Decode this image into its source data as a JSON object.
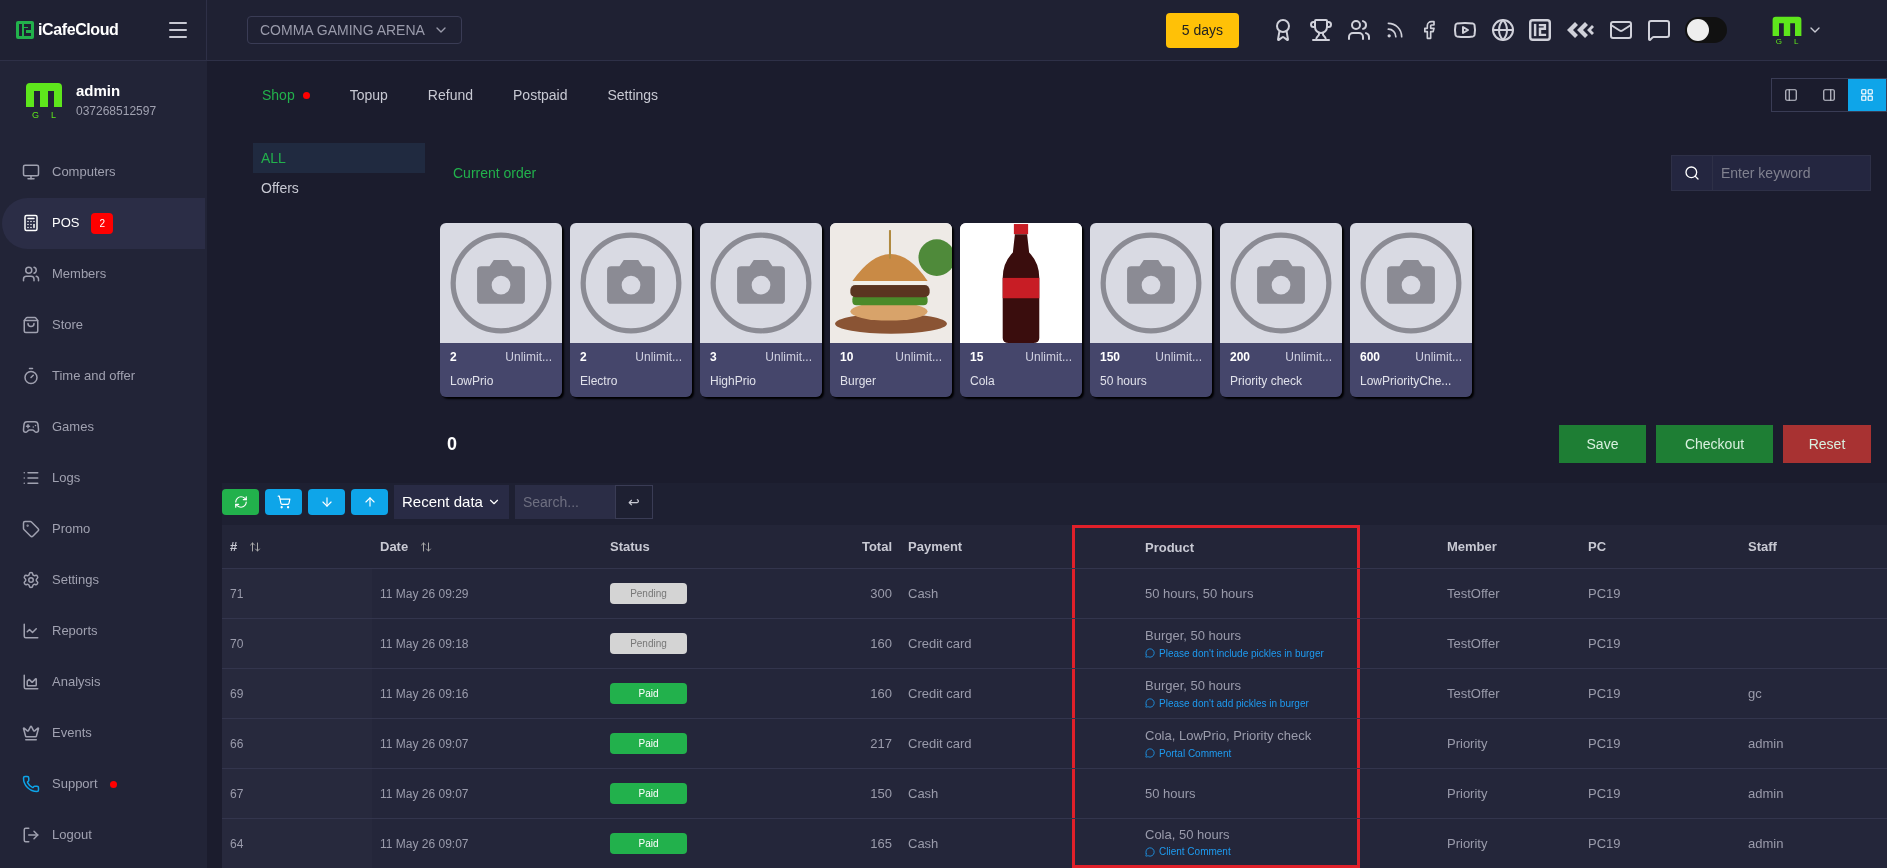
{
  "brand": "iCafeCloud",
  "venue": "COMMA GAMING ARENA",
  "days_badge": "5 days",
  "account_logo_letters": [
    "G",
    "L"
  ],
  "theme_toggle": {
    "on": false
  },
  "user": {
    "name": "admin",
    "phone": "037268512597",
    "logo_letters": [
      "G",
      "L"
    ]
  },
  "sidebar": {
    "items": [
      {
        "label": "Computers",
        "selected": false
      },
      {
        "label": "POS",
        "selected": true,
        "badge": "2"
      },
      {
        "label": "Members",
        "selected": false
      },
      {
        "label": "Store",
        "selected": false
      },
      {
        "label": "Time and offer",
        "selected": false
      },
      {
        "label": "Games",
        "selected": false
      },
      {
        "label": "Logs",
        "selected": false
      },
      {
        "label": "Promo",
        "selected": false
      },
      {
        "label": "Settings",
        "selected": false
      },
      {
        "label": "Reports",
        "selected": false
      },
      {
        "label": "Analysis",
        "selected": false
      },
      {
        "label": "Events",
        "selected": false
      },
      {
        "label": "Support",
        "selected": false,
        "dot": true
      },
      {
        "label": "Logout",
        "selected": false
      }
    ]
  },
  "tabs": [
    {
      "label": "Shop",
      "selected": true,
      "dot": true
    },
    {
      "label": "Topup",
      "selected": false
    },
    {
      "label": "Refund",
      "selected": false
    },
    {
      "label": "Postpaid",
      "selected": false
    },
    {
      "label": "Settings",
      "selected": false
    }
  ],
  "view_toggles": [
    {
      "selected": false
    },
    {
      "selected": false
    },
    {
      "selected": true
    }
  ],
  "categories": [
    {
      "label": "ALL",
      "selected": true
    },
    {
      "label": "Offers",
      "selected": false
    }
  ],
  "current_order": "Current order",
  "search": {
    "placeholder": "Enter keyword"
  },
  "products": [
    {
      "price": "2",
      "stock": "Unlimit...",
      "name": "LowPrio",
      "kind": "placeholder"
    },
    {
      "price": "2",
      "stock": "Unlimit...",
      "name": "Electro",
      "kind": "placeholder"
    },
    {
      "price": "3",
      "stock": "Unlimit...",
      "name": "HighPrio",
      "kind": "placeholder"
    },
    {
      "price": "10",
      "stock": "Unlimit...",
      "name": "Burger",
      "kind": "burger"
    },
    {
      "price": "15",
      "stock": "Unlimit...",
      "name": "Cola",
      "kind": "bottle"
    },
    {
      "price": "150",
      "stock": "Unlimit...",
      "name": "50 hours",
      "kind": "placeholder"
    },
    {
      "price": "200",
      "stock": "Unlimit...",
      "name": "Priority check",
      "kind": "placeholder"
    },
    {
      "price": "600",
      "stock": "Unlimit...",
      "name": "LowPriorityChe...",
      "kind": "placeholder"
    }
  ],
  "order_total": "0",
  "actions": [
    "Save",
    "Checkout",
    "Reset"
  ],
  "filter": {
    "range": "Recent data",
    "placeholder": "Search...",
    "enter": "↩"
  },
  "table": {
    "columns": [
      {
        "label": "#",
        "sortable": true
      },
      {
        "label": "Date",
        "sortable": true
      },
      {
        "label": "Status",
        "sortable": false
      },
      {
        "label": "Total",
        "sortable": false
      },
      {
        "label": "Payment",
        "sortable": false
      },
      {
        "label": "Product",
        "sortable": false,
        "highlighted": true
      },
      {
        "label": "Member",
        "sortable": false
      },
      {
        "label": "PC",
        "sortable": false
      },
      {
        "label": "Staff",
        "sortable": false
      }
    ],
    "rows": [
      {
        "id": "71",
        "date": "11 May 26 09:29",
        "status": "Pending",
        "paid": false,
        "total": "300",
        "payment": "Cash",
        "product": "50 hours, 50 hours",
        "member": "TestOffer",
        "pc": "PC19"
      },
      {
        "id": "70",
        "date": "11 May 26 09:18",
        "status": "Pending",
        "paid": false,
        "total": "160",
        "payment": "Credit card",
        "product": "Burger, 50 hours",
        "comment": "Please don't include pickles in burger",
        "member": "TestOffer",
        "pc": "PC19"
      },
      {
        "id": "69",
        "date": "11 May 26 09:16",
        "status": "Paid",
        "paid": true,
        "total": "160",
        "payment": "Credit card",
        "product": "Burger, 50 hours",
        "comment": "Please don't add pickles in burger",
        "member": "TestOffer",
        "pc": "PC19",
        "staff": "gc"
      },
      {
        "id": "66",
        "date": "11 May 26 09:07",
        "status": "Paid",
        "paid": true,
        "total": "217",
        "payment": "Credit card",
        "product": "Cola, LowPrio, Priority check",
        "comment": "Portal Comment",
        "member": "Priority",
        "pc": "PC19",
        "staff": "admin"
      },
      {
        "id": "67",
        "date": "11 May 26 09:07",
        "status": "Paid",
        "paid": true,
        "total": "150",
        "payment": "Cash",
        "product": "50 hours",
        "member": "Priority",
        "pc": "PC19",
        "staff": "admin"
      },
      {
        "id": "64",
        "date": "11 May 26 09:07",
        "status": "Paid",
        "paid": true,
        "total": "165",
        "payment": "Cash",
        "product": "Cola, 50 hours",
        "comment": "Client Comment",
        "member": "Priority",
        "pc": "PC19",
        "staff": "admin"
      }
    ]
  }
}
